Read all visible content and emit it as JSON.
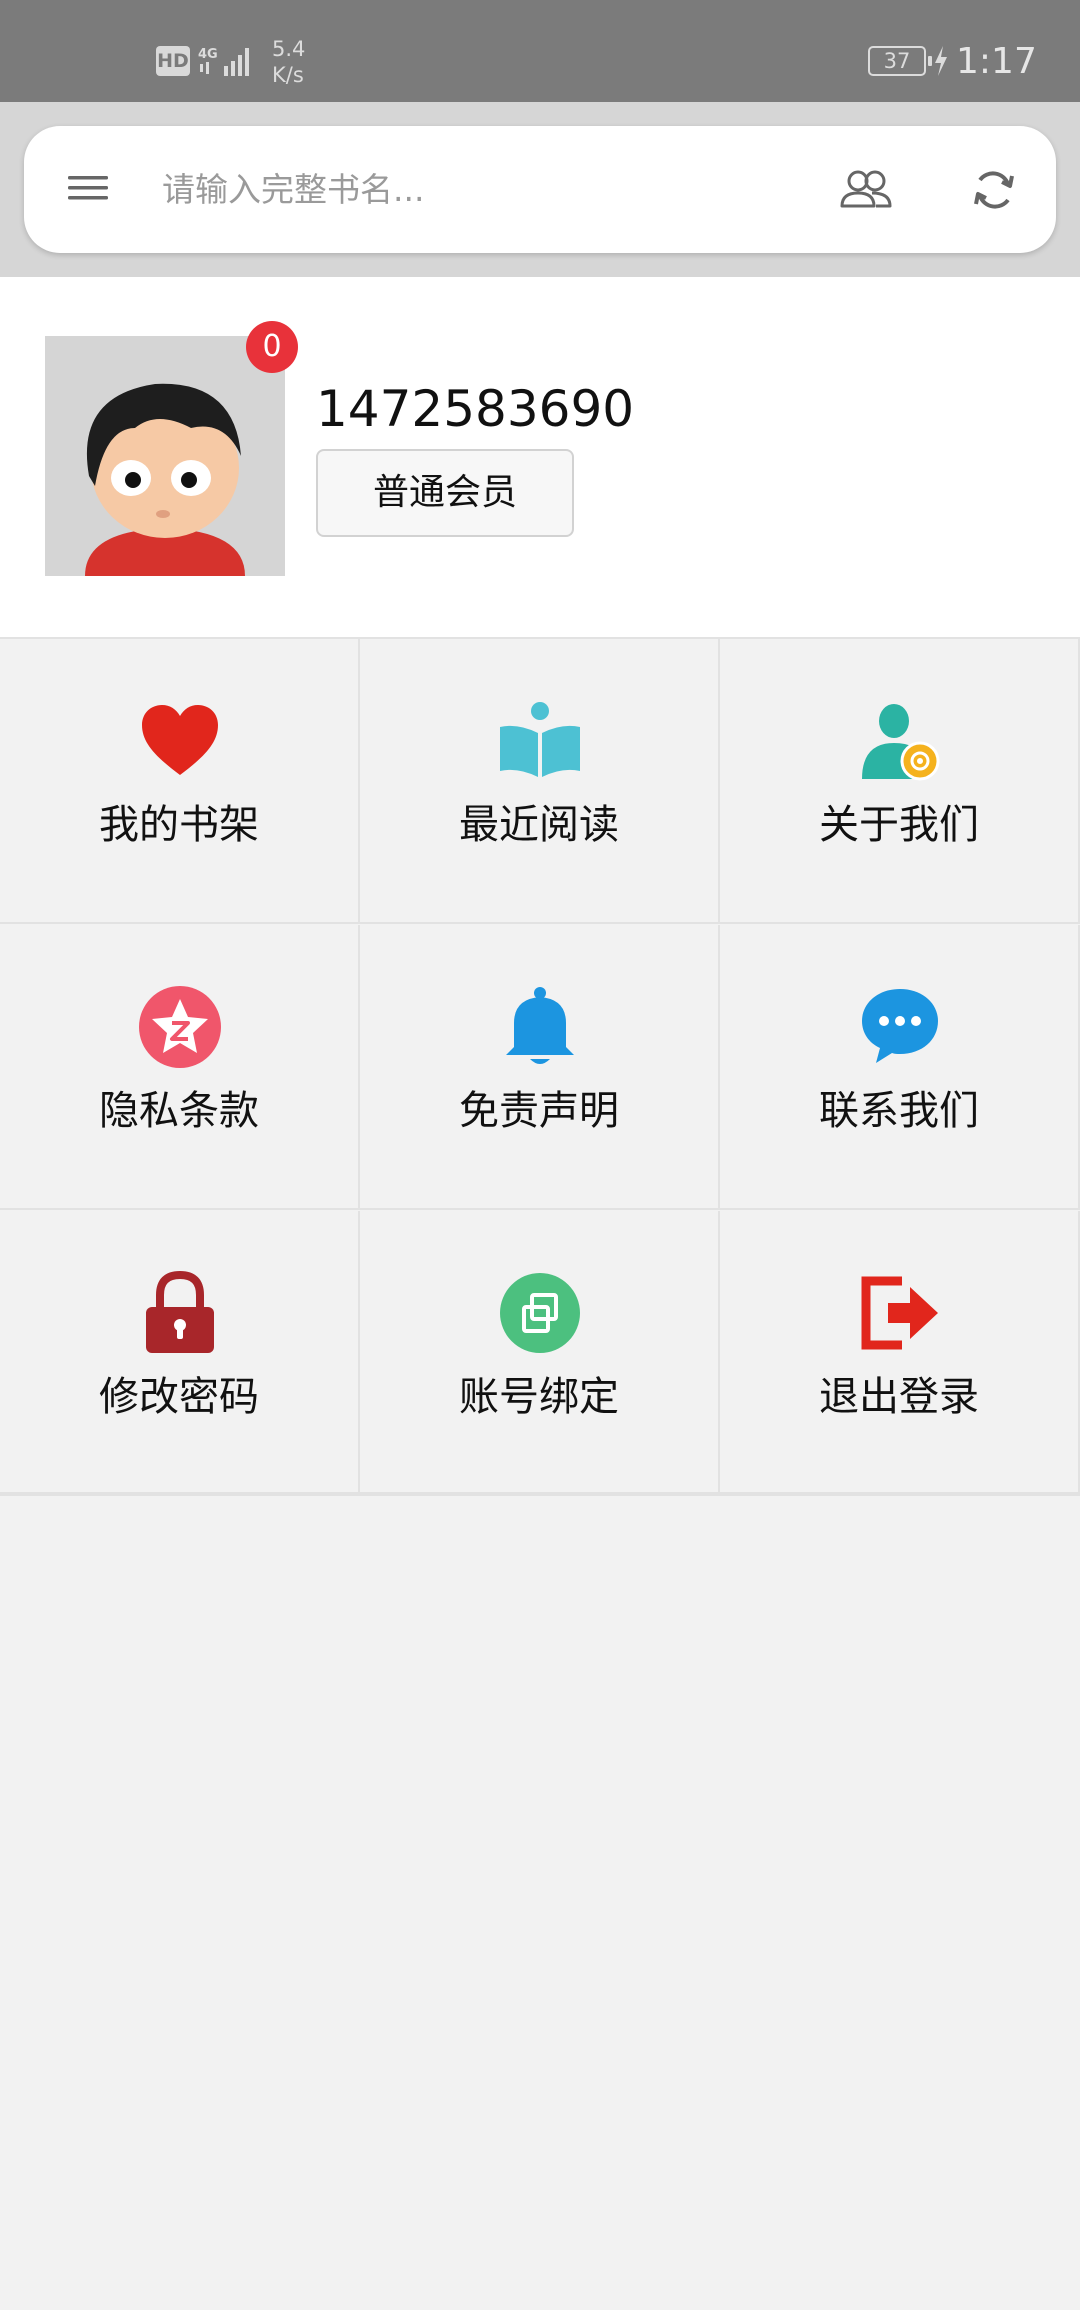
{
  "status_bar": {
    "hd": "HD",
    "net_speed_value": "5.4",
    "net_speed_unit": "K/s",
    "battery": "37",
    "time": "1:17"
  },
  "search": {
    "placeholder": "请输入完整书名..."
  },
  "profile": {
    "badge_count": "0",
    "username": "1472583690",
    "member_label": "普通会员"
  },
  "menu": {
    "items": [
      {
        "label": "我的书架",
        "icon": "heart-icon",
        "color": "#e1261c"
      },
      {
        "label": "最近阅读",
        "icon": "open-book-icon",
        "color": "#4dc1d3"
      },
      {
        "label": "关于我们",
        "icon": "user-settings-icon",
        "color": "#2bb3a3"
      },
      {
        "label": "隐私条款",
        "icon": "star-circle-icon",
        "color": "#f0566b"
      },
      {
        "label": "免责声明",
        "icon": "bell-icon",
        "color": "#1c95e0"
      },
      {
        "label": "联系我们",
        "icon": "chat-bubble-icon",
        "color": "#1c95e0"
      },
      {
        "label": "修改密码",
        "icon": "lock-icon",
        "color": "#a8262a"
      },
      {
        "label": "账号绑定",
        "icon": "link-account-icon",
        "color": "#4cc07f"
      },
      {
        "label": "退出登录",
        "icon": "logout-icon",
        "color": "#e1261c"
      }
    ]
  }
}
